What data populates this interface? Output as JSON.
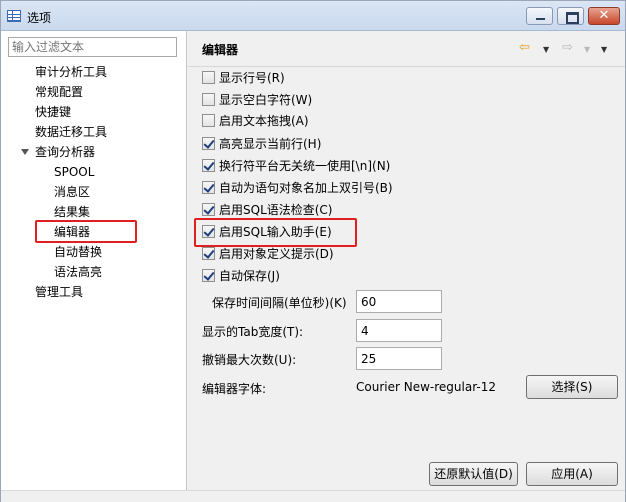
{
  "window": {
    "title": "选项"
  },
  "filter": {
    "placeholder": "输入过滤文本"
  },
  "tree": {
    "audit": "审计分析工具",
    "config": "常规配置",
    "shortcuts": "快捷键",
    "migration": "数据迁移工具",
    "query_analyzer": "查询分析器",
    "spool": "SPOOL",
    "message_area": "消息区",
    "result_set": "结果集",
    "editor": "编辑器",
    "auto_replace": "自动替换",
    "syntax_highlight": "语法高亮",
    "management": "管理工具"
  },
  "page": {
    "title": "编辑器"
  },
  "nav": {
    "back": "⇦",
    "back_dd": "▼",
    "forward": "⇨",
    "forward_dd": "▼",
    "menu": "▼"
  },
  "options": [
    {
      "label": "显示行号(R)",
      "checked": false
    },
    {
      "label": "显示空白字符(W)",
      "checked": false
    },
    {
      "label": "启用文本拖拽(A)",
      "checked": false
    },
    {
      "label": "高亮显示当前行(H)",
      "checked": true
    },
    {
      "label": "换行符平台无关统一使用[\\n](N)",
      "checked": true
    },
    {
      "label": "自动为语句对象名加上双引号(B)",
      "checked": true
    },
    {
      "label": "启用SQL语法检查(C)",
      "checked": true
    },
    {
      "label": "启用SQL输入助手(E)",
      "checked": true
    },
    {
      "label": "启用对象定义提示(D)",
      "checked": true
    },
    {
      "label": "自动保存(J)",
      "checked": true
    }
  ],
  "fields": {
    "save_interval_label": "保存时间间隔(单位秒)(K)",
    "save_interval_value": "60",
    "tab_width_label": "显示的Tab宽度(T):",
    "tab_width_value": "4",
    "undo_max_label": "撤销最大次数(U):",
    "undo_max_value": "25",
    "font_label": "编辑器字体:",
    "font_value": "Courier New-regular-12"
  },
  "buttons": {
    "choose": "选择(S)",
    "restore": "还原默认值(D)",
    "apply": "应用(A)"
  },
  "colors": {
    "highlight_box": "#e02020"
  }
}
